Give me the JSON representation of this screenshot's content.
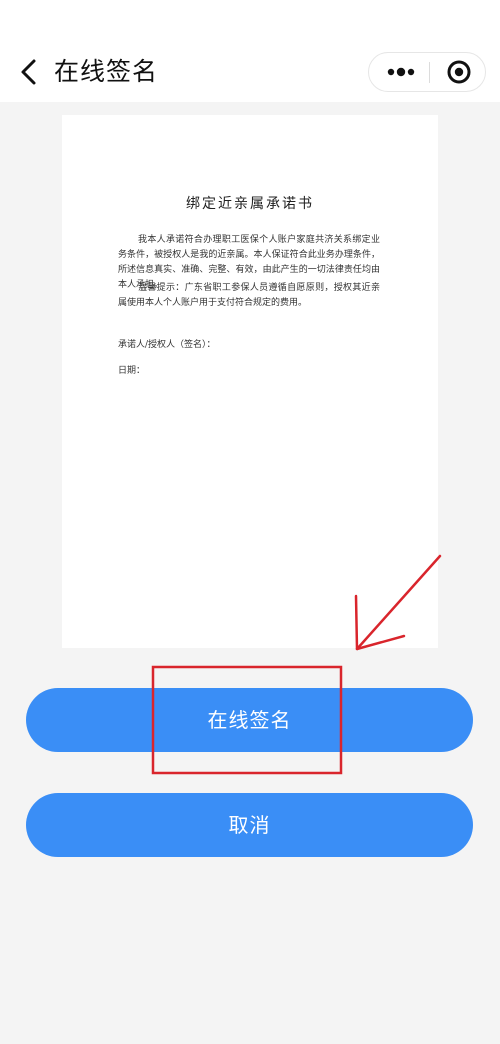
{
  "nav": {
    "title": "在线签名",
    "back_icon": "chevron-left-icon",
    "more_icon": "more-dots-icon",
    "close_icon": "target-circle-icon"
  },
  "document": {
    "title": "绑定近亲属承诺书",
    "paragraph1": "我本人承诺符合办理职工医保个人账户家庭共济关系绑定业务条件，被授权人是我的近亲属。本人保证符合此业务办理条件，所述信息真实、准确、完整、有效，由此产生的一切法律责任均由本人承担。",
    "paragraph2": "温馨提示：广东省职工参保人员遵循自愿原则，授权其近亲属使用本人个人账户用于支付符合规定的费用。",
    "signer_label": "承诺人/授权人（签名）：",
    "date_label": "日期："
  },
  "buttons": {
    "sign_label": "在线签名",
    "cancel_label": "取消"
  },
  "colors": {
    "primary_button": "#3a8ef6",
    "annotation": "#d9252c",
    "background": "#f4f4f4"
  }
}
